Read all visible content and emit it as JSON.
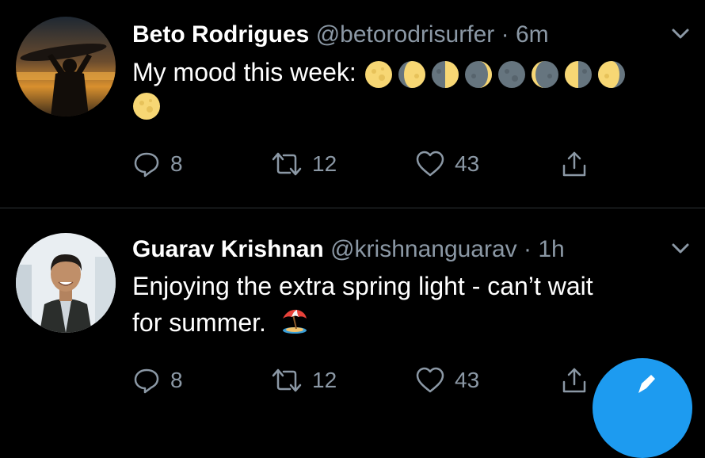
{
  "tweets": [
    {
      "name": "Beto Rodrigues",
      "handle": "@betorodrisurfer",
      "separator": "·",
      "time": "6m",
      "text": "My mood this week:",
      "emoji_names": [
        "full-moon",
        "waxing-gibbous-moon",
        "first-quarter-moon",
        "waxing-crescent-moon",
        "new-moon",
        "waning-crescent-moon",
        "last-quarter-moon",
        "waning-gibbous-moon",
        "full-moon"
      ],
      "replies": "8",
      "retweets": "12",
      "likes": "43"
    },
    {
      "name": "Guarav Krishnan",
      "handle": "@krishnanguarav",
      "separator": "·",
      "time": "1h",
      "text_line1": "Enjoying the extra spring light - can’t wait",
      "text_line2": "for summer.",
      "emoji": "beach-umbrella-emoji",
      "replies": "8",
      "retweets": "12",
      "likes": "43"
    }
  ],
  "colors": {
    "background": "#000000",
    "muted": "#8b98a5",
    "divider": "#2f3336",
    "accent": "#1d9bf0",
    "moon_yellow": "#f7d774",
    "moon_dark": "#66757f"
  },
  "icons": {
    "reply": "reply-icon",
    "retweet": "retweet-icon",
    "like": "heart-icon",
    "share": "share-icon",
    "more": "chevron-down-icon",
    "compose": "compose-icon"
  }
}
